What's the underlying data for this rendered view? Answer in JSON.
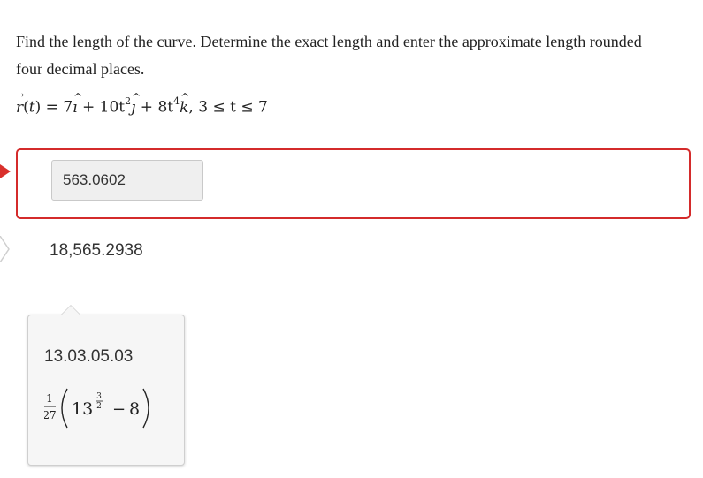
{
  "question": {
    "text": "Find the length of the curve. Determine the exact length and enter the approximate length rounded four decimal places."
  },
  "formula": {
    "lhs": "r(t)",
    "i_coef": "7",
    "j_coef": "10t",
    "k_coef": "8t",
    "j_exp": "2",
    "k_exp": "4",
    "range": "3 ≤ t ≤ 7"
  },
  "answer": {
    "value": "563.0602",
    "status": "incorrect",
    "border_color": "#d42b2b"
  },
  "correct_answer": {
    "value": "18,565.2938"
  },
  "tooltip": {
    "code": "13.03.05.03",
    "fraction_num": "1",
    "fraction_den": "27",
    "base": "13",
    "exp_num": "3",
    "exp_den": "2",
    "minus_term": "8"
  }
}
